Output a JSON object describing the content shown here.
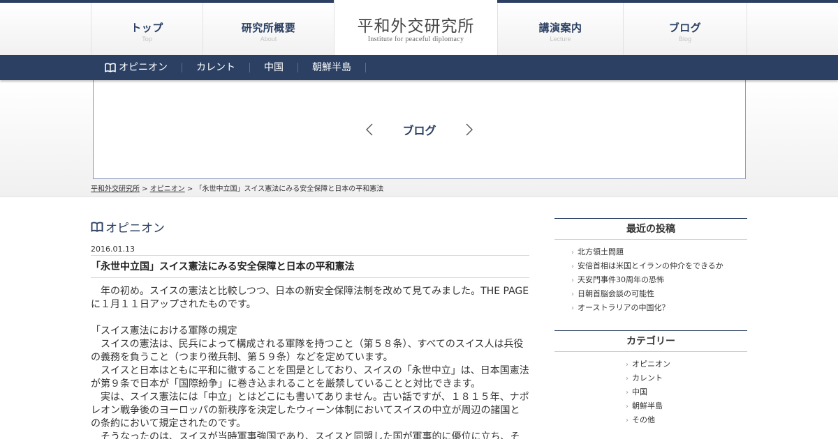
{
  "header": {
    "nav": [
      {
        "jp": "トップ",
        "en": "Top"
      },
      {
        "jp": "研究所概要",
        "en": "About"
      }
    ],
    "logo": {
      "jp": "平和外交研究所",
      "en": "Institute for peaceful diplomacy"
    },
    "nav_right": [
      {
        "jp": "講演案内",
        "en": "Lecture"
      },
      {
        "jp": "ブログ",
        "en": "Blog"
      }
    ]
  },
  "subnav": [
    "オピニオン",
    "カレント",
    "中国",
    "朝鮮半島"
  ],
  "hero": {
    "title": "ブログ"
  },
  "breadcrumb": {
    "home": "平和外交研究所",
    "sep1": " > ",
    "category": "オピニオン",
    "sep2": " > ",
    "current": "「永世中立国」スイス憲法にみる安全保障と日本の平和憲法"
  },
  "post": {
    "category": "オピニオン",
    "date": "2016.01.13",
    "title": "「永世中立国」スイス憲法にみる安全保障と日本の平和憲法",
    "paragraphs": [
      "　年の初め。スイスの憲法と比較しつつ、日本の新安全保障法制を改めて見てみました。THE PAGEに１月１１日アップされたものです。",
      "",
      "「スイス憲法における軍隊の規定",
      "　スイスの憲法は、民兵によって構成される軍隊を持つこと（第５８条）、すべてのスイス人は兵役の義務を負うこと（つまり徴兵制、第５９条）などを定めています。",
      "　スイスと日本はともに平和に徹することを国是としており、スイスの「永世中立」は、日本国憲法が第９条で日本が「国際紛争」に巻き込まれることを厳禁していることと対比できます。",
      "　実は、スイス憲法には「中立」とはどこにも書いてありません。古い話ですが、１８１５年、ナポレオン戦争後のヨーロッパの新秩序を決定したウィーン体制においてスイスの中立が周辺の諸国との条約において規定されたのです。",
      "　そうなったのは、スイスが当時軍事強国であり、スイスと同盟した国が軍事的に優位に立ち、そ"
    ]
  },
  "sidebar": {
    "recent_title": "最近の投稿",
    "recent": [
      "北方領土問題",
      "安倍首相は米国とイランの仲介をできるか",
      "天安門事件30周年の恐怖",
      "日朝首脳会談の可能性",
      "オーストラリアの中国化？"
    ],
    "categories_title": "カテゴリー",
    "categories": [
      "オピニオン",
      "カレント",
      "中国",
      "朝鮮半島",
      "その他"
    ]
  },
  "colors": {
    "brand": "#2b4063",
    "border": "#8e9bb6"
  }
}
